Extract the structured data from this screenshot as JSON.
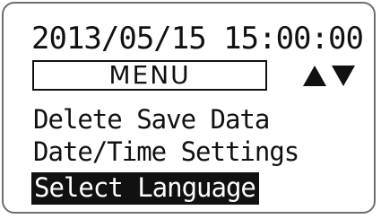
{
  "screen": {
    "datetime": "2013/05/15  15:00:00",
    "menu_title": "MENU",
    "scroll_icons": [
      "up-triangle-icon",
      "down-triangle-icon"
    ],
    "menu_items": [
      {
        "label": "Delete Save Data",
        "selected": false
      },
      {
        "label": "Date/Time Settings",
        "selected": false
      },
      {
        "label": "Select Language",
        "selected": true
      }
    ]
  },
  "colors": {
    "foreground": "#111111",
    "background": "#ffffff",
    "frame": "#6f6f6f",
    "highlight_bg": "#111111",
    "highlight_fg": "#ffffff"
  }
}
